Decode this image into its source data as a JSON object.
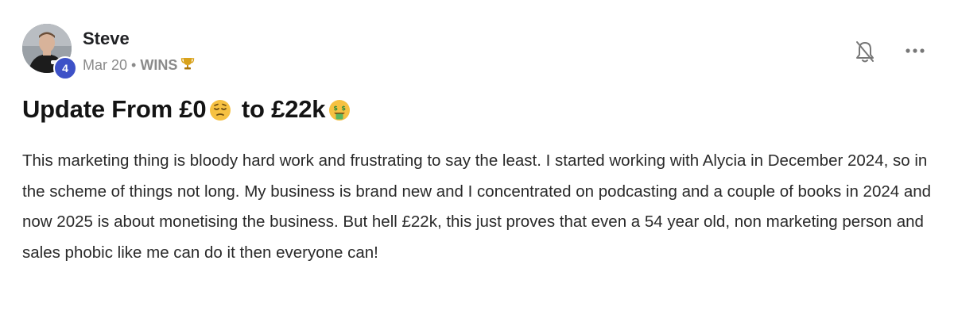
{
  "post": {
    "author": {
      "name": "Steve",
      "level": "4"
    },
    "meta": {
      "date": "Mar 20",
      "separator": "•",
      "category": "WINS",
      "category_icon": "trophy-icon"
    },
    "actions": {
      "bell_icon": "bell-off-icon",
      "more_icon": "more-horizontal-icon"
    },
    "title": {
      "part1": "Update From £0",
      "emoji1": "pensive-face-emoji",
      "part2": " to £22k",
      "emoji2": "money-mouth-face-emoji"
    },
    "body": "This marketing thing is bloody hard work and frustrating to say the least. I started working with Alycia in December 2024, so in the scheme of things not long. My business is brand new and I concentrated on podcasting and a couple of books in 2024 and now 2025 is about monetising the business. But hell £22k, this just proves that even a 54 year old, non marketing person and sales phobic like me can do it then everyone can!"
  },
  "colors": {
    "level_badge": "#3d51c7",
    "meta_text": "#8a8a8a",
    "title_text": "#141414",
    "body_text": "#2a2a2a"
  }
}
